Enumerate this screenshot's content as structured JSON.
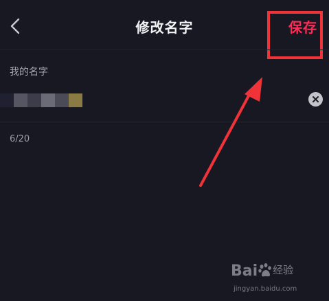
{
  "header": {
    "title": "修改名字",
    "save_label": "保存",
    "back_icon": "chevron-left-icon"
  },
  "form": {
    "label": "我的名字",
    "value_obscured": true,
    "mosaic_colors": [
      "#1f2030",
      "#555661",
      "#3c3d4a",
      "#6a6b76",
      "#4a4b57",
      "#8a7a44"
    ],
    "clear_icon": "close-circle-icon",
    "counter": "6/20"
  },
  "annotation": {
    "highlight_color": "#ef3338",
    "arrow_color": "#ef3338"
  },
  "watermark": {
    "logo_prefix": "Bai",
    "logo_suffix": "经验",
    "url": "jingyan.baidu.com"
  },
  "colors": {
    "background": "#171822",
    "accent": "#fe2c55",
    "label": "#a5a7b0"
  }
}
